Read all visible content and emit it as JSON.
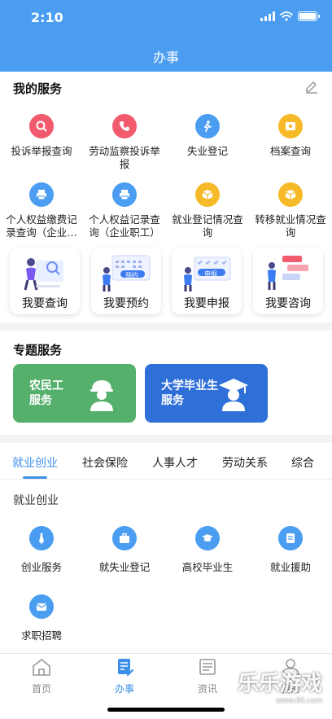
{
  "status_bar": {
    "time": "2:10"
  },
  "header": {
    "title": "办事"
  },
  "my_services": {
    "title": "我的服务",
    "items": [
      {
        "label": "投诉举报查询",
        "icon": "search-magnifier-icon",
        "color": "#f25a6e"
      },
      {
        "label": "劳动监察投诉举报",
        "icon": "phone-icon",
        "color": "#f25a6e"
      },
      {
        "label": "失业登记",
        "icon": "running-person-icon",
        "color": "#4a9df0"
      },
      {
        "label": "档案查询",
        "icon": "folder-icon",
        "color": "#f6b928"
      },
      {
        "label": "个人权益缴费记录查询（企业职工）",
        "icon": "printer-icon",
        "color": "#4a9df0"
      },
      {
        "label": "个人权益记录查询（企业职工）",
        "icon": "printer-icon",
        "color": "#4a9df0"
      },
      {
        "label": "就业登记情况查询",
        "icon": "box-icon",
        "color": "#f6b928"
      },
      {
        "label": "转移就业情况查询",
        "icon": "box-icon",
        "color": "#f6b928"
      }
    ],
    "big_actions": [
      {
        "label": "我要查询"
      },
      {
        "label": "我要预约",
        "badge": "预约"
      },
      {
        "label": "我要申报",
        "badge": "申报"
      },
      {
        "label": "我要咨询"
      }
    ]
  },
  "topics": {
    "title": "专题服务",
    "items": [
      {
        "line1": "农民工",
        "line2": "服务",
        "color": "#55b06c",
        "icon": "worker-helmet-icon"
      },
      {
        "line1": "大学毕业生",
        "line2": "服务",
        "color": "#2f6fd8",
        "icon": "graduate-cap-icon"
      }
    ]
  },
  "category_tabs": [
    "就业创业",
    "社会保险",
    "人事人才",
    "劳动关系",
    "综合"
  ],
  "active_tab": "就业创业",
  "category": {
    "heading": "就业创业",
    "items": [
      {
        "label": "创业服务",
        "icon": "tie-icon"
      },
      {
        "label": "就失业登记",
        "icon": "briefcase-icon"
      },
      {
        "label": "高校毕业生",
        "icon": "graduate-cap-icon"
      },
      {
        "label": "就业援助",
        "icon": "document-icon"
      },
      {
        "label": "求职招聘",
        "icon": "envelope-icon"
      }
    ]
  },
  "bottom_nav": [
    {
      "label": "首页",
      "icon": "home-icon"
    },
    {
      "label": "办事",
      "icon": "document-pen-icon"
    },
    {
      "label": "资讯",
      "icon": "newspaper-icon"
    },
    {
      "label": "我的",
      "icon": "person-icon"
    }
  ],
  "watermark": {
    "text": "乐乐游戏",
    "url": "www.6ll.com"
  }
}
